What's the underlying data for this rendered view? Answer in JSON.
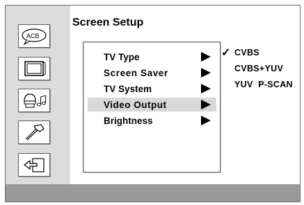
{
  "screen": {
    "title": "Screen Setup"
  },
  "sidebar": {
    "icons": [
      {
        "name": "language-icon",
        "glyph": "ACB"
      },
      {
        "name": "tv-icon"
      },
      {
        "name": "audio-icon"
      },
      {
        "name": "tools-icon"
      },
      {
        "name": "exit-icon"
      }
    ]
  },
  "menu": {
    "items": [
      {
        "label": "TV Type"
      },
      {
        "label": "Screen Saver"
      },
      {
        "label": "TV System"
      },
      {
        "label": "Video Output",
        "selected": true
      },
      {
        "label": "Brightness"
      }
    ]
  },
  "submenu": {
    "check_glyph": "✓",
    "options": [
      {
        "label": "CVBS",
        "checked": true
      },
      {
        "label": "CVBS+YUV"
      },
      {
        "label": "YUV  P-SCAN"
      }
    ]
  },
  "colors": {
    "sidebar_bg": "#dcdcdc",
    "selected_bg": "#d8d8d8",
    "footer_bg": "#9a9a9a"
  }
}
